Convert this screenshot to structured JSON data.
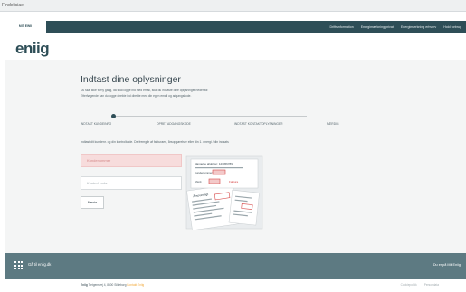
{
  "browser": {
    "tab_title": "Findeliciae"
  },
  "topnav": {
    "brand_tab": "MIT EWII",
    "links": [
      "Driftsinformation",
      "Energimærkning privat",
      "Energimærkning erhverv",
      "Hold forbrug"
    ]
  },
  "logo": "eniig",
  "main": {
    "title": "Indtast dine oplysninger",
    "intro_line1": "Du skal ikke forny gang, da skal logge ind med email, skal du indtaste dine oplysninger nedenfor.",
    "intro_line2": "Efterfølgende kan du logge direkte ind direkte med din egen email og adgangskode.",
    "steps": [
      "INDTAST KUNDEINFO",
      "OPRET ADGANGSKODE",
      "INDTAST KONTAKTOPLYSNINGER",
      "FÆRDIG"
    ],
    "help_text": "Indtast dit kundenr. og din kontrolkode. De fremgår af fakturaen, årsopgørelser eller din 1. energi / din indsats",
    "customer_placeholder": "Kundenummer",
    "code_placeholder": "Kontrol kode",
    "next_button": "Næste"
  },
  "invoice": {
    "line1": "Mangelse afskriver: 123456789",
    "line2": "Kundenummer",
    "line3": "Afsnit",
    "line4": "Faktura",
    "section": "Årsoversigt"
  },
  "footer": {
    "go_link": "Gå til eniig.dk",
    "right_link": "Du er på Mit Eniig",
    "copyright_prefix": "Eniig",
    "copyright_text": "Tietgensvej 4, 8600 Silkeborg",
    "copyright_accent": "Kontakt Eniig",
    "links": [
      "Cookiepolitik",
      "Persondata"
    ]
  },
  "colors": {
    "accent": "#2e4e57",
    "error_bg": "#f7dcdc",
    "footer_bg": "#5d7a82",
    "highlight": "#f2a93b"
  }
}
